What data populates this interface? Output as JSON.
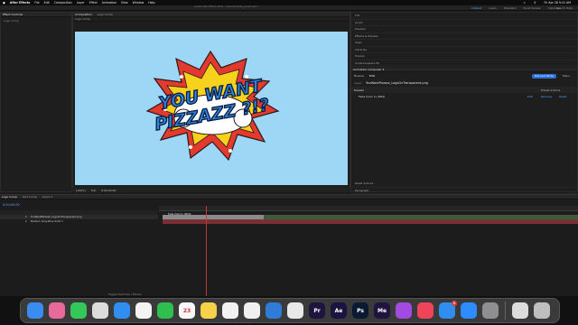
{
  "menubar": {
    "app_name": "After Effects",
    "items": [
      "File",
      "Edit",
      "Composition",
      "Layer",
      "Effect",
      "Animation",
      "View",
      "Window",
      "Help"
    ],
    "date_time": "Fri Apr 28 9:41 AM"
  },
  "window": {
    "title": "Adobe After Effects 2023 - /Users/pizzazz_project.aep *"
  },
  "workspaces": {
    "items": [
      "Default",
      "Learn",
      "Standard",
      "Small Screen",
      "Libraries"
    ],
    "active_index": 0,
    "search_help": "Search Help"
  },
  "project_panel": {
    "tabs": [
      "Effect Controls",
      "Composition"
    ],
    "comp_name": "Logo Comp"
  },
  "viewer": {
    "text_line1": "YOU WANT",
    "text_line2": "PIZZAZZ ?!?",
    "zoom": "(100%)",
    "resolution": "Full",
    "timecode": "0:00:00:00"
  },
  "right_panel": {
    "top_items": [
      "Info",
      "Audio",
      "Preview",
      "Effects & Presets",
      "Align",
      "Libraries",
      "Tracker",
      "Content-Aware Fill"
    ],
    "section_title": "Animation Composer 3",
    "tabs": [
      "Browse",
      "Edit"
    ],
    "active_tab": "Edit",
    "layer_label": "Layer:",
    "layer_name": "YouWantPizzazz_LogoOnTransparent.png",
    "presets_label": "Presets",
    "preset_actions": "Preset Actions",
    "preset_row": "Fade Color In (Wild)",
    "preset_row_buttons": [
      "Edit",
      "Remove",
      "Reset"
    ],
    "discover_packs": "Discover Packs",
    "menu_label": "Menu",
    "reset_actions": "Reset Actions",
    "lower_items": [
      "Paragraph",
      "Capsule"
    ]
  },
  "timeline": {
    "tabs": [
      "Logo Comp",
      "Text Comp",
      "Layer 3"
    ],
    "timecode": "0:00:00:00",
    "layers": [
      {
        "num": "1",
        "name": "YouWantPizzazz_LogoOnTransparent.png"
      },
      {
        "num": "2",
        "name": "Medium Gray-Blue Solid 1"
      }
    ],
    "clip_label": "Fade Color In (Wild)",
    "footer": "Toggle Switches / Modes"
  },
  "dock": {
    "apps": [
      {
        "name": "Finder",
        "label": "",
        "color": "#3b8cf0"
      },
      {
        "name": "Launchpad",
        "label": "",
        "color": "#e86a9a"
      },
      {
        "name": "Messages",
        "label": "",
        "color": "#34c759"
      },
      {
        "name": "Chrome",
        "label": "",
        "color": "#dcdcdc"
      },
      {
        "name": "Mail",
        "label": "",
        "color": "#2f8ef0"
      },
      {
        "name": "Photos",
        "label": "",
        "color": "#f3f3f3"
      },
      {
        "name": "FaceTime",
        "label": "",
        "color": "#2fbf4f"
      },
      {
        "name": "Calendar",
        "label": "23",
        "color": "#f8f8f8"
      },
      {
        "name": "Notes",
        "label": "",
        "color": "#f5d24a"
      },
      {
        "name": "Reminders",
        "label": "",
        "color": "#f2f2f2"
      },
      {
        "name": "Slack",
        "label": "",
        "color": "#f0f0f0"
      },
      {
        "name": "Keynote",
        "label": "",
        "color": "#2f7bd8"
      },
      {
        "name": "Safari",
        "label": "",
        "color": "#e8e8e8"
      },
      {
        "name": "Premiere Pro",
        "label": "Pr",
        "color": "#1f1440"
      },
      {
        "name": "After Effects",
        "label": "Ae",
        "color": "#1a1440"
      },
      {
        "name": "Photoshop",
        "label": "Ps",
        "color": "#0b1a33"
      },
      {
        "name": "Media Encoder",
        "label": "Me",
        "color": "#1f1440"
      },
      {
        "name": "Podcasts",
        "label": "",
        "color": "#a34be0"
      },
      {
        "name": "Music",
        "label": "",
        "color": "#f0445a"
      },
      {
        "name": "App Store",
        "label": "",
        "color": "#2f8ef0",
        "badge": "1"
      },
      {
        "name": "Zoom",
        "label": "",
        "color": "#2d8cff"
      },
      {
        "name": "System Settings",
        "label": "",
        "color": "#8e8e93"
      },
      {
        "name": "Preview",
        "label": "",
        "color": "#dcdcdc"
      },
      {
        "name": "Trash",
        "label": "",
        "color": "#bfbfbf"
      }
    ]
  }
}
